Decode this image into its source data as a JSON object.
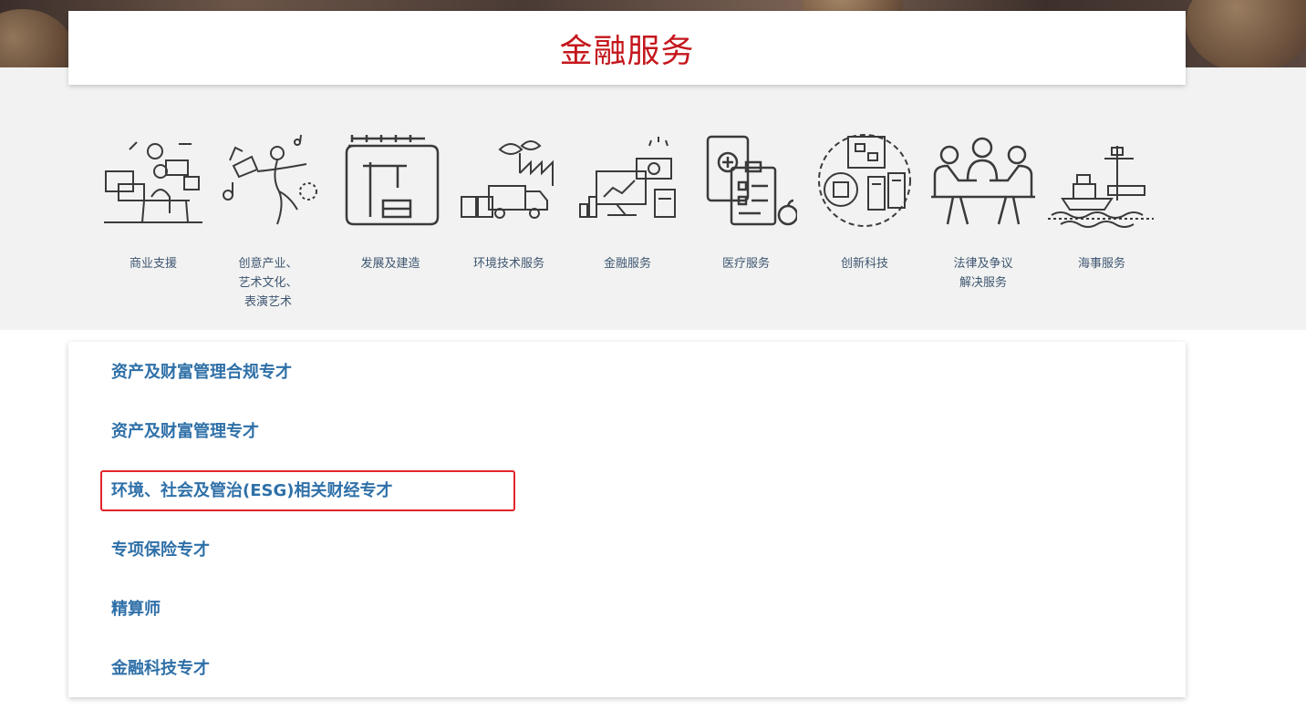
{
  "header": {
    "title": "金融服务"
  },
  "sectors": [
    {
      "icon": "business-support-icon",
      "label": "商业支援"
    },
    {
      "icon": "creative-arts-icon",
      "label": "创意产业、\n艺术文化、\n表演艺术"
    },
    {
      "icon": "construction-icon",
      "label": "发展及建造"
    },
    {
      "icon": "environment-icon",
      "label": "环境技术服务"
    },
    {
      "icon": "finance-icon",
      "label": "金融服务"
    },
    {
      "icon": "medical-icon",
      "label": "医疗服务"
    },
    {
      "icon": "innotech-icon",
      "label": "创新科技"
    },
    {
      "icon": "legal-icon",
      "label": "法律及争议\n解决服务"
    },
    {
      "icon": "maritime-icon",
      "label": "海事服务"
    }
  ],
  "talent_list": {
    "items": [
      "资产及财富管理合规专才",
      "资产及财富管理专才",
      "环境、社会及管治(ESG)相关财经专才",
      "专项保险专才",
      "精算师",
      "金融科技专才"
    ],
    "highlighted_index": 2
  },
  "colors": {
    "title": "#c4161c",
    "link": "#2f70a8",
    "highlight": "#e2242b",
    "icon": "#3a3a3a"
  }
}
